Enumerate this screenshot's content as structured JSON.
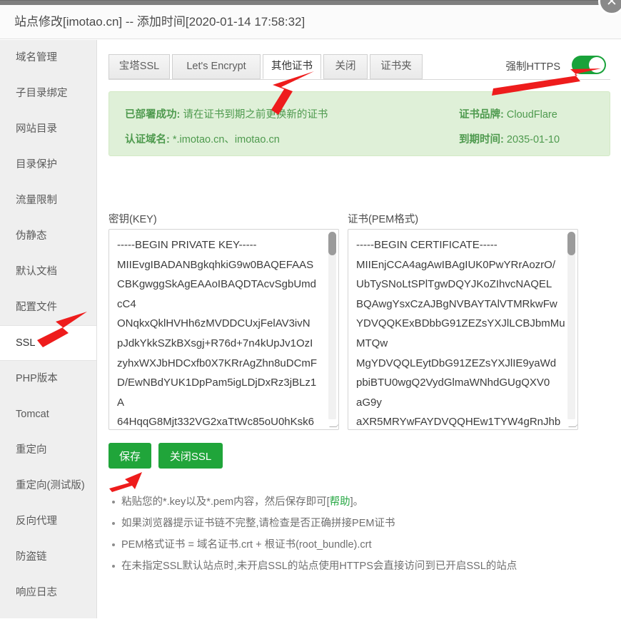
{
  "window": {
    "title": "站点修改[imotao.cn] -- 添加时间[2020-01-14 17:58:32]",
    "close_icon": "close-icon",
    "close_glyph": "✕"
  },
  "sidebar": {
    "items": [
      {
        "label": "域名管理",
        "active": false
      },
      {
        "label": "子目录绑定",
        "active": false
      },
      {
        "label": "网站目录",
        "active": false
      },
      {
        "label": "目录保护",
        "active": false
      },
      {
        "label": "流量限制",
        "active": false
      },
      {
        "label": "伪静态",
        "active": false
      },
      {
        "label": "默认文档",
        "active": false
      },
      {
        "label": "配置文件",
        "active": false
      },
      {
        "label": "SSL",
        "active": true
      },
      {
        "label": "PHP版本",
        "active": false
      },
      {
        "label": "Tomcat",
        "active": false
      },
      {
        "label": "重定向",
        "active": false
      },
      {
        "label": "重定向(测试版)",
        "active": false
      },
      {
        "label": "反向代理",
        "active": false
      },
      {
        "label": "防盗链",
        "active": false
      },
      {
        "label": "响应日志",
        "active": false
      }
    ]
  },
  "tabs": [
    {
      "label": "宝塔SSL",
      "active": false
    },
    {
      "label": "Let's Encrypt",
      "active": false
    },
    {
      "label": "其他证书",
      "active": true
    },
    {
      "label": "关闭",
      "active": false
    },
    {
      "label": "证书夹",
      "active": false
    }
  ],
  "force_https": {
    "label": "强制HTTPS",
    "enabled": true,
    "on_color": "#19a23a"
  },
  "info_panel": {
    "status_label": "已部署成功:",
    "status_value": "请在证书到期之前更换新的证书",
    "domains_label": "认证域名:",
    "domains_value": "*.imotao.cn、imotao.cn",
    "brand_label": "证书品牌:",
    "brand_value": "CloudFlare",
    "expire_label": "到期时间:",
    "expire_value": "2035-01-10",
    "bg_color": "#dff0d8",
    "text_color": "#4e9a4e"
  },
  "key_field": {
    "label": "密钥(KEY)",
    "value": "-----BEGIN PRIVATE KEY-----\nMIIEvgIBADANBgkqhkiG9w0BAQEFAAS\nCBKgwggSkAgEAAoIBAQDTAcvSgbUmd\ncC4\nONqkxQklHVHh6zMVDDCUxjFelAV3ivN\npJdkYkkSZkBXsgj+R76d+7n4kUpJv1OzI\nzyhxWXJbHDCxfb0X7KRrAgZhn8uDCmF\nD/EwNBdYUK1DpPam5igLDjDxRz3jBLz1\nA\n64HqqG8Mjt332VG2xaTtWc85oU0hKsk6"
  },
  "pem_field": {
    "label": "证书(PEM格式)",
    "value": "-----BEGIN CERTIFICATE-----\nMIIEnjCCA4agAwIBAgIUK0PwYRrAozrO/\nUbTySNoLtSPlTgwDQYJKoZIhvcNAQEL\nBQAwgYsxCzAJBgNVBAYTAlVTMRkwFw\nYDVQQKExBDbbG91ZEZsYXJlLCBJbmMu\nMTQw\nMgYDVQQLEytDbG91ZEZsYXJlIE9yaWd\npbiBTU0wgQ2VydGlmaWNhdGUgQXV0\naG9y\naXR5MRYwFAYDVQQHEw1TYW4gRnJhb"
  },
  "buttons": {
    "save": "保存",
    "close_ssl": "关闭SSL",
    "color": "#20a53a"
  },
  "notes": [
    {
      "before": "粘贴您的*.key以及*.pem内容，然后保存即可[",
      "link": "帮助",
      "after": "]。"
    },
    {
      "before": "如果浏览器提示证书链不完整,请检查是否正确拼接PEM证书",
      "link": "",
      "after": ""
    },
    {
      "before": "PEM格式证书 = 域名证书.crt + 根证书(root_bundle).crt",
      "link": "",
      "after": ""
    },
    {
      "before": "在未指定SSL默认站点时,未开启SSL的站点使用HTTPS会直接访问到已开启SSL的站点",
      "link": "",
      "after": ""
    }
  ],
  "annotations": {
    "arrow_color": "#ee1c1c",
    "arrows": [
      "arrow-to-other-cert-tab",
      "arrow-to-force-https-toggle",
      "arrow-to-ssl-sidebar",
      "arrow-to-save-button"
    ]
  }
}
